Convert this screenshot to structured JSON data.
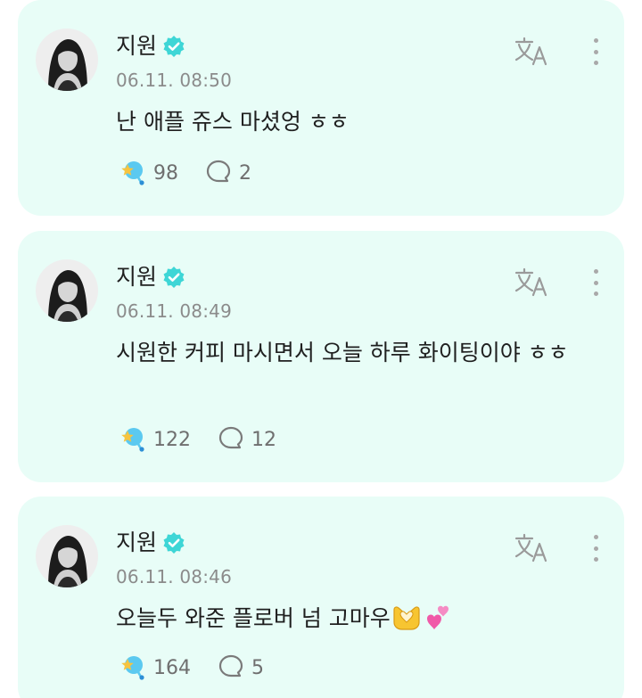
{
  "posts": [
    {
      "author": "지원",
      "timestamp": "06.11. 08:50",
      "text": "난 애플 쥬스 마셨엉 ㅎㅎ",
      "likes": "98",
      "comments": "2",
      "emojis": []
    },
    {
      "author": "지원",
      "timestamp": "06.11. 08:49",
      "text": "시원한 커피 마시면서 오늘 하루 화이팅이야 ㅎㅎ",
      "likes": "122",
      "comments": "12",
      "emojis": []
    },
    {
      "author": "지원",
      "timestamp": "06.11. 08:46",
      "text": "오늘두 와준 플로버 넘 고마우",
      "likes": "164",
      "comments": "5",
      "emojis": [
        "heart-hands-emoji",
        "two-hearts-emoji"
      ]
    }
  ],
  "colors": {
    "card_background": "#e8fdf7",
    "verified_badge": "#3ed6d6",
    "like_accent": "#5bc9f0",
    "like_star": "#f6c440"
  }
}
